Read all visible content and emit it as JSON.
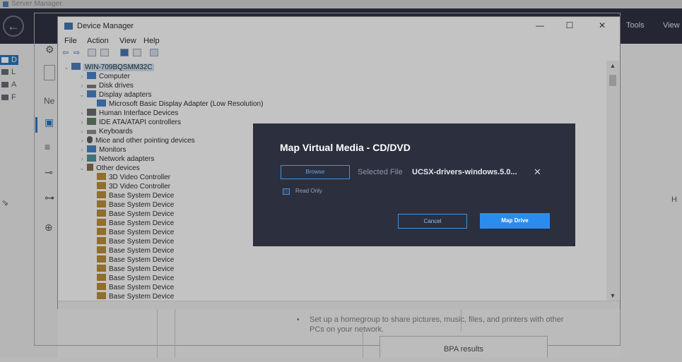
{
  "server_manager": {
    "title": "Server Manager",
    "menu": [
      "Tools",
      "View"
    ],
    "left_nav": [
      "D",
      "L",
      "A",
      "F"
    ],
    "center_text": "Ne",
    "right_char": "H",
    "homegroup_text": "Set up a homegroup to share pictures, music, files, and printers with other PCs on your network.",
    "bpa_label": "BPA results"
  },
  "device_manager": {
    "title": "Device Manager",
    "controls": {
      "minimize": "—",
      "maximize": "☐",
      "close": "✕"
    },
    "menu": [
      "File",
      "Action",
      "View",
      "Help"
    ],
    "tree": [
      {
        "label": "WIN-709BQSMM32C",
        "level": 0,
        "expanded": true,
        "icon": "computer-icon",
        "selected": true
      },
      {
        "label": "Computer",
        "level": 1,
        "expanded": false,
        "icon": "computer-icon"
      },
      {
        "label": "Disk drives",
        "level": 1,
        "expanded": false,
        "icon": "disk-icon"
      },
      {
        "label": "Display adapters",
        "level": 1,
        "expanded": true,
        "icon": "display-icon"
      },
      {
        "label": "Microsoft Basic Display Adapter (Low Resolution)",
        "level": 2,
        "icon": "display-icon"
      },
      {
        "label": "Human Interface Devices",
        "level": 1,
        "expanded": false,
        "icon": "hid-icon"
      },
      {
        "label": "IDE ATA/ATAPI controllers",
        "level": 1,
        "expanded": false,
        "icon": "ide-icon"
      },
      {
        "label": "Keyboards",
        "level": 1,
        "expanded": false,
        "icon": "keyboard-icon"
      },
      {
        "label": "Mice and other pointing devices",
        "level": 1,
        "expanded": false,
        "icon": "mouse-icon"
      },
      {
        "label": "Monitors",
        "level": 1,
        "expanded": false,
        "icon": "monitor-icon"
      },
      {
        "label": "Network adapters",
        "level": 1,
        "expanded": false,
        "icon": "network-icon"
      },
      {
        "label": "Other devices",
        "level": 1,
        "expanded": true,
        "icon": "unknown-device-icon"
      },
      {
        "label": "3D Video Controller",
        "level": 2,
        "icon": "warning-device-icon"
      },
      {
        "label": "3D Video Controller",
        "level": 2,
        "icon": "warning-device-icon"
      },
      {
        "label": "Base System Device",
        "level": 2,
        "icon": "warning-device-icon"
      },
      {
        "label": "Base System Device",
        "level": 2,
        "icon": "warning-device-icon"
      },
      {
        "label": "Base System Device",
        "level": 2,
        "icon": "warning-device-icon"
      },
      {
        "label": "Base System Device",
        "level": 2,
        "icon": "warning-device-icon"
      },
      {
        "label": "Base System Device",
        "level": 2,
        "icon": "warning-device-icon"
      },
      {
        "label": "Base System Device",
        "level": 2,
        "icon": "warning-device-icon"
      },
      {
        "label": "Base System Device",
        "level": 2,
        "icon": "warning-device-icon"
      },
      {
        "label": "Base System Device",
        "level": 2,
        "icon": "warning-device-icon"
      },
      {
        "label": "Base System Device",
        "level": 2,
        "icon": "warning-device-icon"
      },
      {
        "label": "Base System Device",
        "level": 2,
        "icon": "warning-device-icon"
      },
      {
        "label": "Base System Device",
        "level": 2,
        "icon": "warning-device-icon"
      },
      {
        "label": "Base System Device",
        "level": 2,
        "icon": "warning-device-icon"
      }
    ]
  },
  "modal": {
    "title": "Map Virtual Media - CD/DVD",
    "browse_label": "Browse",
    "selected_file_label": "Selected File",
    "selected_file_value": "UCSX-drivers-windows.5.0...",
    "clear_glyph": "✕",
    "read_only_label": "Read Only",
    "cancel_label": "Cancel",
    "map_drive_label": "Map Drive"
  },
  "colors": {
    "modal_bg": "#2c2f3e",
    "accent": "#2b8cf0",
    "header_bg": "#24263a"
  }
}
